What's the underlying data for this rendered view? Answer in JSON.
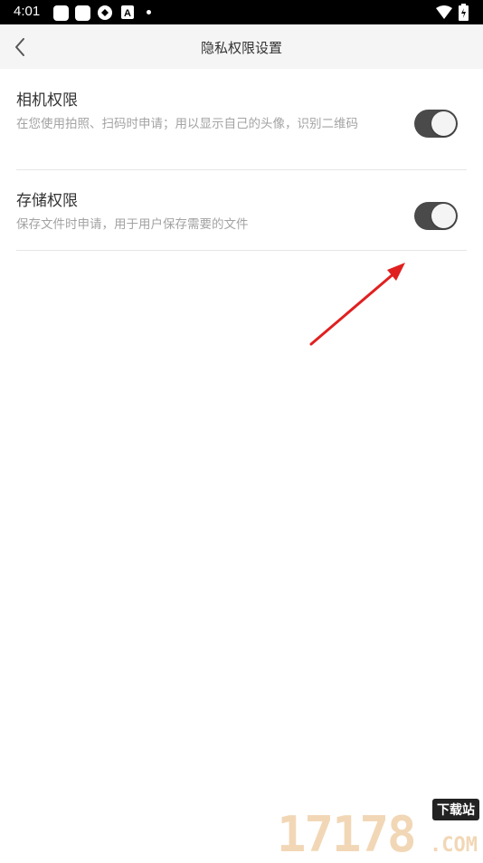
{
  "status_bar": {
    "time": "4:01"
  },
  "header": {
    "title": "隐私权限设置"
  },
  "permissions": [
    {
      "title": "相机权限",
      "description": "在您使用拍照、扫码时申请；用以显示自己的头像，识别二维码",
      "enabled": true
    },
    {
      "title": "存储权限",
      "description": "保存文件时申请，用于用户保存需要的文件",
      "enabled": true
    }
  ],
  "watermark": {
    "number": "17178",
    "tag": "下载站",
    "domain": ".COM"
  },
  "colors": {
    "toggle_on": "#4a4a4a",
    "arrow": "#e02020",
    "header_bg": "#f5f5f5"
  }
}
